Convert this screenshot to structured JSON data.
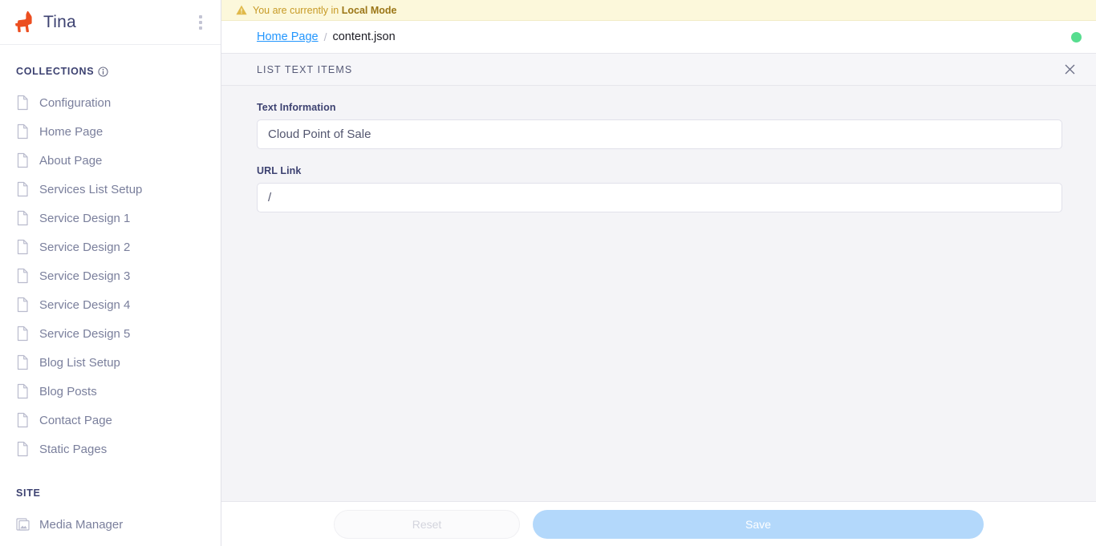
{
  "sidebar": {
    "brand": "Tina",
    "logo_icon": "llama-logo",
    "menu_icon": "kebab-menu-icon",
    "logo_color": "#ec4e20",
    "collections": {
      "title": "COLLECTIONS",
      "info_icon": "info-circle-icon",
      "items": [
        {
          "label": "Configuration",
          "icon": "document-icon"
        },
        {
          "label": "Home Page",
          "icon": "document-icon"
        },
        {
          "label": "About Page",
          "icon": "document-icon"
        },
        {
          "label": "Services List Setup",
          "icon": "document-icon"
        },
        {
          "label": "Service Design 1",
          "icon": "document-icon"
        },
        {
          "label": "Service Design 2",
          "icon": "document-icon"
        },
        {
          "label": "Service Design 3",
          "icon": "document-icon"
        },
        {
          "label": "Service Design 4",
          "icon": "document-icon"
        },
        {
          "label": "Service Design 5",
          "icon": "document-icon"
        },
        {
          "label": "Blog List Setup",
          "icon": "document-icon"
        },
        {
          "label": "Blog Posts",
          "icon": "document-icon"
        },
        {
          "label": "Contact Page",
          "icon": "document-icon"
        },
        {
          "label": "Static Pages",
          "icon": "document-icon"
        }
      ]
    },
    "site": {
      "title": "SITE",
      "items": [
        {
          "label": "Media Manager",
          "icon": "image-stack-icon"
        }
      ]
    }
  },
  "banner": {
    "icon": "warning-triangle-icon",
    "text_prefix": "You are currently in ",
    "mode": "Local Mode",
    "background": "#fcf8db",
    "text_color": "#c79a26"
  },
  "breadcrumb": {
    "parent": "Home Page",
    "separator": "/",
    "current": "content.json",
    "status_dot": "online-status-dot",
    "status_color": "#57dd8f"
  },
  "panel": {
    "title": "LIST TEXT ITEMS",
    "close_icon": "close-icon"
  },
  "form": {
    "fields": [
      {
        "label": "Text Information",
        "value": "Cloud Point of Sale",
        "placeholder": ""
      },
      {
        "label": "URL Link",
        "value": "/",
        "placeholder": ""
      }
    ]
  },
  "footer": {
    "reset_label": "Reset",
    "save_label": "Save",
    "save_color": "#b3d8fb"
  }
}
